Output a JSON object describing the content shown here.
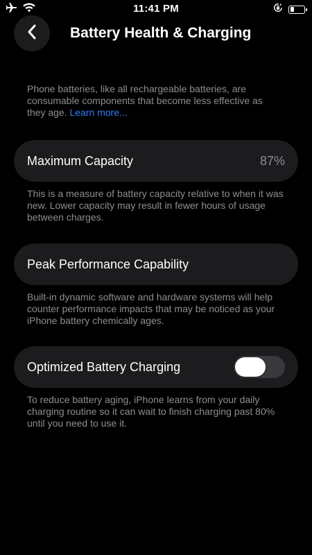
{
  "status_bar": {
    "time": "11:41 PM",
    "left_icons": [
      "airplane-icon",
      "wifi-icon"
    ],
    "right_icons": [
      "orientation-lock-icon",
      "battery-icon"
    ]
  },
  "header": {
    "title": "Battery Health & Charging",
    "back_icon": "chevron-left-icon"
  },
  "intro": {
    "text": "Phone batteries, like all rechargeable batteries, are consumable components that become less effective as they age.",
    "link": "Learn more..."
  },
  "maximum_capacity": {
    "label": "Maximum Capacity",
    "value": "87%",
    "description": "This is a measure of battery capacity relative to when it was new. Lower capacity may result in fewer hours of usage between charges."
  },
  "peak_performance": {
    "label": "Peak Performance Capability",
    "description": "Built-in dynamic software and hardware systems will help counter performance impacts that may be noticed as your iPhone battery chemically ages."
  },
  "optimized_charging": {
    "label": "Optimized Battery Charging",
    "enabled": false,
    "description": "To reduce battery aging, iPhone learns from your daily charging routine so it can wait to finish charging past 80% until you need to use it."
  },
  "colors": {
    "background": "#000000",
    "card": "#1c1c1e",
    "secondary_text": "#8e8e93",
    "link": "#2f7df6",
    "toggle_off": "#39393d"
  }
}
